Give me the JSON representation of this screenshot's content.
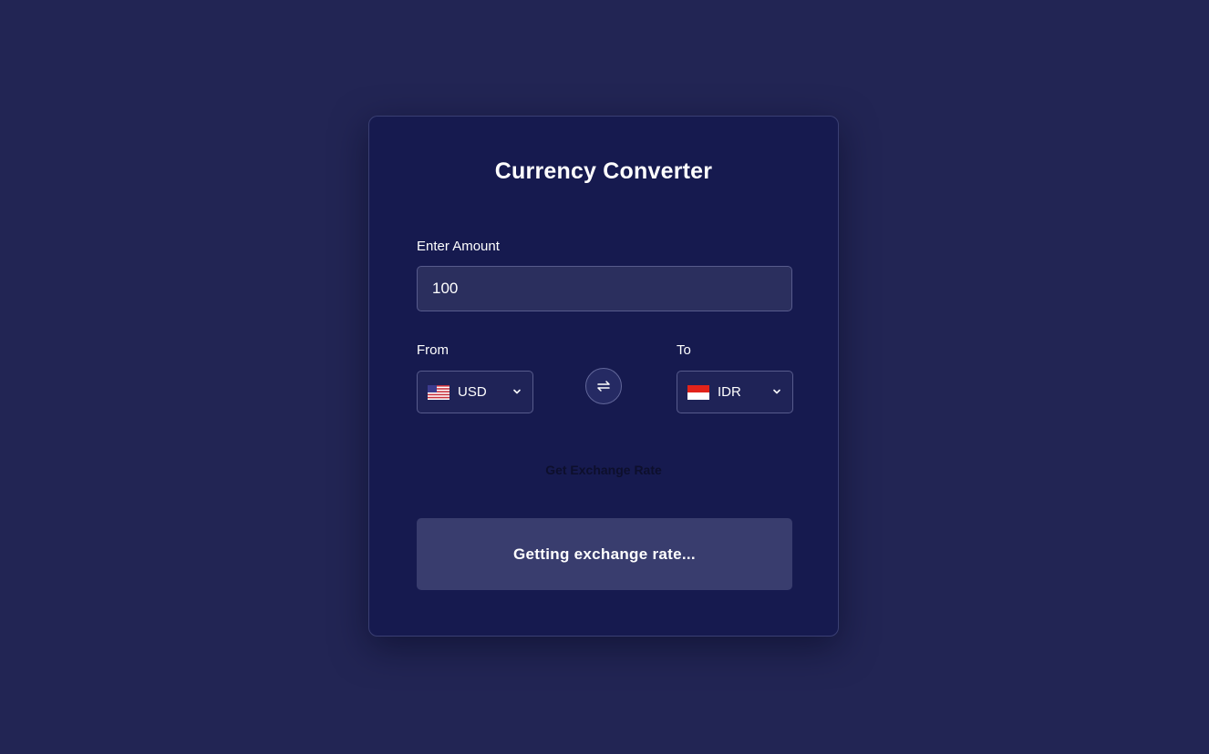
{
  "app": {
    "title": "Currency Converter"
  },
  "amount": {
    "label": "Enter Amount",
    "value": "100"
  },
  "from": {
    "label": "From",
    "currency": "USD",
    "flag_icon": "us-flag-icon"
  },
  "to": {
    "label": "To",
    "currency": "IDR",
    "flag_icon": "indonesia-flag-icon"
  },
  "swap": {
    "icon": "swap-arrows-icon"
  },
  "actions": {
    "get_rate_label": "Get Exchange Rate"
  },
  "result": {
    "status_text": "Getting exchange rate..."
  },
  "colors": {
    "page_background": "#222554",
    "card_background": "#161a4f",
    "input_background": "#2b2f5e",
    "result_background": "#393d6e"
  }
}
